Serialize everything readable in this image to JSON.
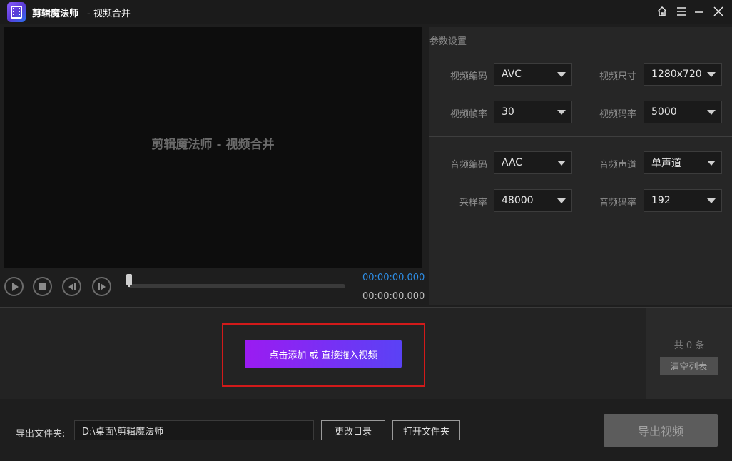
{
  "titlebar": {
    "app_name": "剪辑魔法师",
    "subtitle": "- 视频合并",
    "icons": [
      "home-icon",
      "menu-icon",
      "minimize-icon",
      "close-icon"
    ]
  },
  "preview": {
    "placeholder": "剪辑魔法师 - 视频合并"
  },
  "player": {
    "current_time": "00:00:00.000",
    "total_time": "00:00:00.000",
    "progress": 0
  },
  "settings": {
    "title": "参数设置",
    "video_codec": {
      "label": "视频编码",
      "value": "AVC"
    },
    "video_size": {
      "label": "视频尺寸",
      "value": "1280x720"
    },
    "frame_rate": {
      "label": "视频帧率",
      "value": "30"
    },
    "video_bitrate": {
      "label": "视频码率",
      "value": "5000"
    },
    "audio_codec": {
      "label": "音频编码",
      "value": "AAC"
    },
    "audio_channel": {
      "label": "音频声道",
      "value": "单声道"
    },
    "sample_rate": {
      "label": "采样率",
      "value": "48000"
    },
    "audio_bitrate": {
      "label": "音频码率",
      "value": "192"
    }
  },
  "drop": {
    "add_label": "点击添加 或 直接拖入视频"
  },
  "list": {
    "count_label": "共 0 条",
    "clear_label": "清空列表"
  },
  "output": {
    "label": "导出文件夹:",
    "path": "D:\\桌面\\剪辑魔法师",
    "change_dir_label": "更改目录",
    "open_folder_label": "打开文件夹",
    "export_label": "导出视频"
  },
  "colors": {
    "accent_blue": "#2e8fe8",
    "button_gradient_start": "#9b1bf2",
    "button_gradient_end": "#5a42f5",
    "highlight_red": "#d21a1a"
  }
}
